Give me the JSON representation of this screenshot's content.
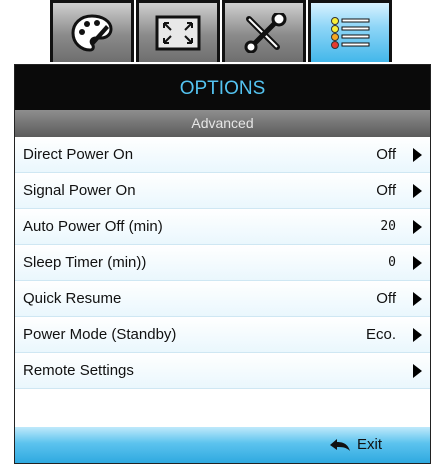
{
  "tabs": [
    {
      "name": "image",
      "icon": "palette-icon"
    },
    {
      "name": "display",
      "icon": "screen-expand-icon"
    },
    {
      "name": "setup",
      "icon": "tools-icon"
    },
    {
      "name": "options",
      "icon": "list-icon",
      "active": true
    }
  ],
  "header": {
    "title": "OPTIONS",
    "subtitle": "Advanced"
  },
  "menu": [
    {
      "label": "Direct Power On",
      "value": "Off"
    },
    {
      "label": "Signal Power On",
      "value": "Off"
    },
    {
      "label": "Auto Power Off (min)",
      "value": "20"
    },
    {
      "label": "Sleep Timer (min))",
      "value": "0"
    },
    {
      "label": "Quick Resume",
      "value": "Off"
    },
    {
      "label": "Power Mode (Standby)",
      "value": "Eco."
    },
    {
      "label": "Remote Settings",
      "value": ""
    }
  ],
  "footer": {
    "exit_label": "Exit"
  },
  "colors": {
    "title_text": "#54c3f0",
    "accent": "#43b7ea"
  }
}
